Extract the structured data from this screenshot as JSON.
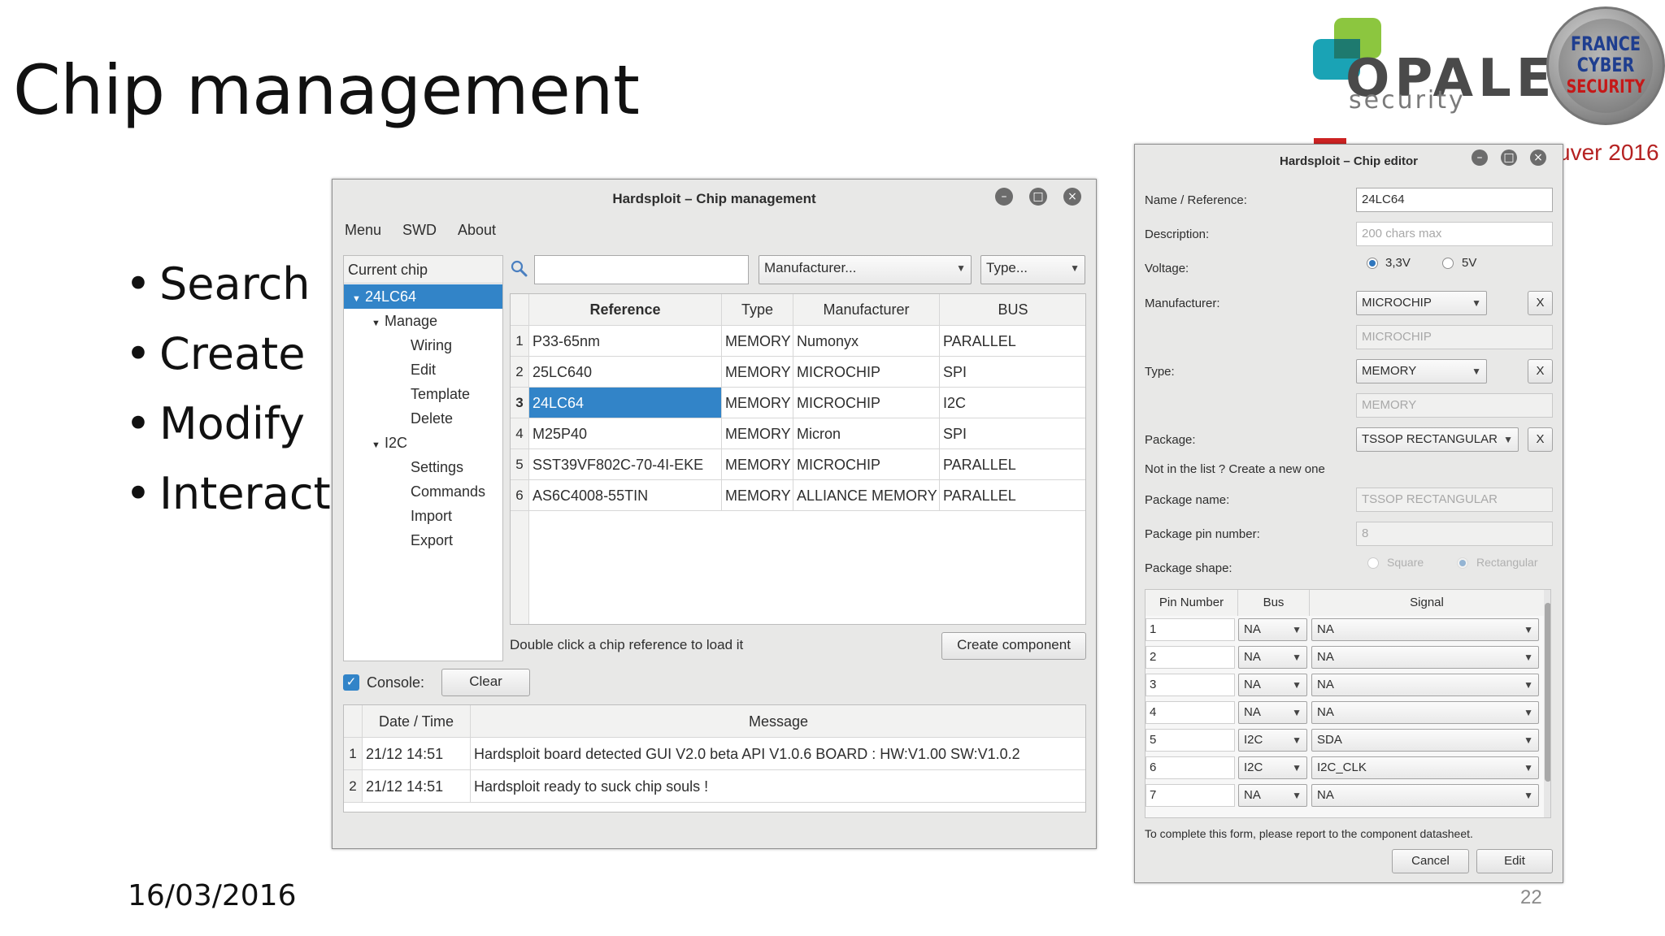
{
  "slide": {
    "title": "Chip management",
    "bullets": [
      "Search",
      "Create",
      "Modify",
      "Interact"
    ],
    "date": "16/03/2016",
    "page_number": "22",
    "event_text": "uver 2016"
  },
  "logos": {
    "opale_word": "OPALE",
    "opale_sub": "security",
    "fcs_line1": "FRANCE",
    "fcs_line2": "CYBER",
    "fcs_line3": "SECURITY"
  },
  "chip_management": {
    "title": "Hardsploit – Chip management",
    "menu": [
      "Menu",
      "SWD",
      "About"
    ],
    "tree": {
      "header": "Current chip",
      "chip": "24LC64",
      "manage": "Manage",
      "manage_items": [
        "Wiring",
        "Edit",
        "Template",
        "Delete"
      ],
      "i2c": "I2C",
      "i2c_items": [
        "Settings",
        "Commands",
        "Import",
        "Export"
      ]
    },
    "search": {
      "value": ""
    },
    "manufacturer_combo": "Manufacturer...",
    "type_combo": "Type...",
    "table": {
      "headers": [
        "Reference",
        "Type",
        "Manufacturer",
        "BUS"
      ],
      "rows": [
        {
          "index": "1",
          "reference": "P33-65nm",
          "type": "MEMORY",
          "manufacturer": "Numonyx",
          "bus": "PARALLEL"
        },
        {
          "index": "2",
          "reference": "25LC640",
          "type": "MEMORY",
          "manufacturer": "MICROCHIP",
          "bus": "SPI"
        },
        {
          "index": "3",
          "reference": "24LC64",
          "type": "MEMORY",
          "manufacturer": "MICROCHIP",
          "bus": "I2C"
        },
        {
          "index": "4",
          "reference": "M25P40",
          "type": "MEMORY",
          "manufacturer": "Micron",
          "bus": "SPI"
        },
        {
          "index": "5",
          "reference": "SST39VF802C-70-4I-EKE",
          "type": "MEMORY",
          "manufacturer": "MICROCHIP",
          "bus": "PARALLEL"
        },
        {
          "index": "6",
          "reference": "AS6C4008-55TIN",
          "type": "MEMORY",
          "manufacturer": "ALLIANCE MEMORY",
          "bus": "PARALLEL"
        }
      ]
    },
    "hint": "Double click a chip reference to load it",
    "create_button": "Create component",
    "console_label": "Console:",
    "console_checked": true,
    "clear_button": "Clear",
    "console_table": {
      "headers": [
        "Date / Time",
        "Message"
      ],
      "rows": [
        {
          "index": "1",
          "datetime": "21/12 14:51",
          "message": "Hardsploit board detected GUI V2.0 beta API V1.0.6 BOARD : HW:V1.00 SW:V1.0.2"
        },
        {
          "index": "2",
          "datetime": "21/12 14:51",
          "message": "Hardsploit ready to suck chip souls !"
        }
      ]
    }
  },
  "chip_editor": {
    "title": "Hardsploit – Chip editor",
    "name_label": "Name / Reference:",
    "name_value": "24LC64",
    "description_label": "Description:",
    "description_placeholder": "200 chars max",
    "voltage_label": "Voltage:",
    "voltage_options": [
      "3,3V",
      "5V"
    ],
    "voltage_selected": "3,3V",
    "manufacturer_label": "Manufacturer:",
    "manufacturer_value": "MICROCHIP",
    "manufacturer_new": "MICROCHIP",
    "type_label": "Type:",
    "type_value": "MEMORY",
    "type_new": "MEMORY",
    "package_label": "Package:",
    "package_value": "TSSOP RECTANGULAR",
    "clear_x": "X",
    "not_in_list": "Not in the list ? Create a new one",
    "package_name_label": "Package name:",
    "package_name_value": "TSSOP RECTANGULAR",
    "package_pin_label": "Package pin number:",
    "package_pin_value": "8",
    "package_shape_label": "Package shape:",
    "shape_options": [
      "Square",
      "Rectangular"
    ],
    "pin_headers": [
      "Pin Number",
      "Bus",
      "Signal"
    ],
    "pins": [
      {
        "number": "1",
        "bus": "NA",
        "signal": "NA"
      },
      {
        "number": "2",
        "bus": "NA",
        "signal": "NA"
      },
      {
        "number": "3",
        "bus": "NA",
        "signal": "NA"
      },
      {
        "number": "4",
        "bus": "NA",
        "signal": "NA"
      },
      {
        "number": "5",
        "bus": "I2C",
        "signal": "SDA"
      },
      {
        "number": "6",
        "bus": "I2C",
        "signal": "I2C_CLK"
      },
      {
        "number": "7",
        "bus": "NA",
        "signal": "NA"
      }
    ],
    "footer_note": "To complete this form, please report to the component datasheet.",
    "cancel_button": "Cancel",
    "edit_button": "Edit"
  },
  "colors": {
    "selection": "#3284c8",
    "window_bg": "#e8e8e7",
    "opale_green": "#8cc63f",
    "opale_teal": "#1aa3b5",
    "fcs_blue": "#1f3e8f",
    "fcs_red": "#c51818"
  },
  "icons": {
    "search": "magnifier-icon",
    "window_controls": [
      "minimize-icon",
      "maximize-icon",
      "close-icon"
    ]
  }
}
